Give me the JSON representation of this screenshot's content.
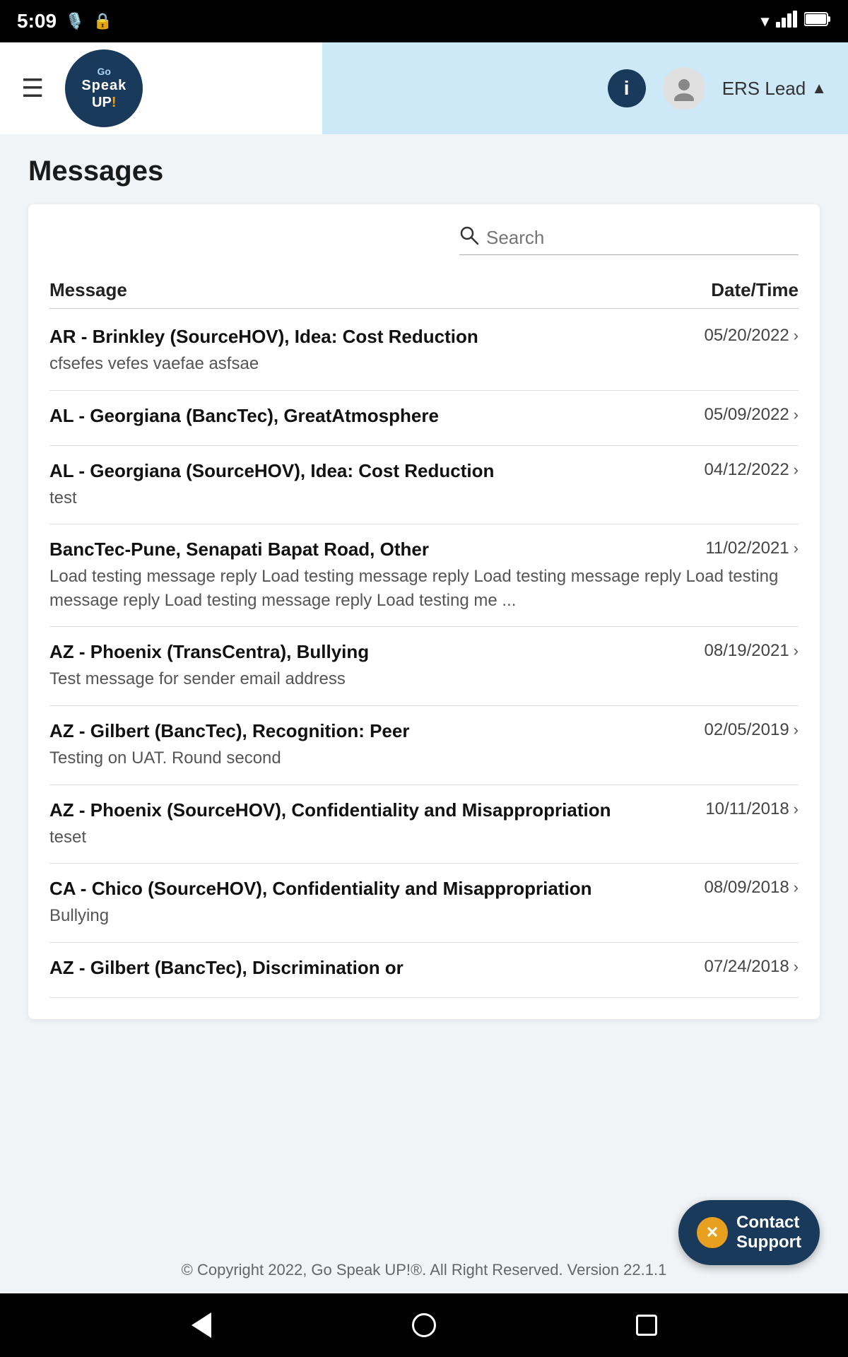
{
  "statusBar": {
    "time": "5:09",
    "wifiIcon": "wifi-icon",
    "signalIcon": "signal-icon",
    "batteryIcon": "battery-icon"
  },
  "header": {
    "hamburgerLabel": "☰",
    "logoLine1": "Go",
    "logoLine2": "Speak",
    "logoLine3": "UP!",
    "infoLabel": "i",
    "userLabel": "ERS Lead",
    "caretLabel": "▲"
  },
  "page": {
    "title": "Messages"
  },
  "search": {
    "placeholder": "Search"
  },
  "tableHeader": {
    "message": "Message",
    "datetime": "Date/Time"
  },
  "messages": [
    {
      "subject": "AR - Brinkley (SourceHOV), Idea: Cost Reduction",
      "preview": "cfsefes vefes vaefae asfsae",
      "date": "05/20/2022"
    },
    {
      "subject": "AL - Georgiana (BancTec), GreatAtmosphere",
      "preview": "",
      "date": "05/09/2022"
    },
    {
      "subject": "AL - Georgiana (SourceHOV), Idea: Cost Reduction",
      "preview": "test",
      "date": "04/12/2022"
    },
    {
      "subject": "BancTec-Pune, Senapati Bapat Road, Other",
      "preview": "Load testing message reply Load testing message reply Load testing message reply Load testing message reply Load testing message reply Load testing me ...",
      "date": "11/02/2021"
    },
    {
      "subject": "AZ - Phoenix (TransCentra), Bullying",
      "preview": "Test message for sender email address",
      "date": "08/19/2021"
    },
    {
      "subject": "AZ - Gilbert (BancTec), Recognition: Peer",
      "preview": "Testing on UAT. Round second",
      "date": "02/05/2019"
    },
    {
      "subject": "AZ - Phoenix (SourceHOV), Confidentiality and Misappropriation",
      "preview": "teset",
      "date": "10/11/2018"
    },
    {
      "subject": "CA - Chico (SourceHOV), Confidentiality and Misappropriation",
      "preview": "Bullying",
      "date": "08/09/2018"
    },
    {
      "subject": "AZ - Gilbert (BancTec), Discrimination or",
      "preview": "",
      "date": "07/24/2018"
    }
  ],
  "contactSupport": {
    "label1": "Contact",
    "label2": "Support"
  },
  "footer": {
    "text": "© Copyright 2022, Go Speak UP!®.  All Right Reserved. Version 22.1.1"
  }
}
